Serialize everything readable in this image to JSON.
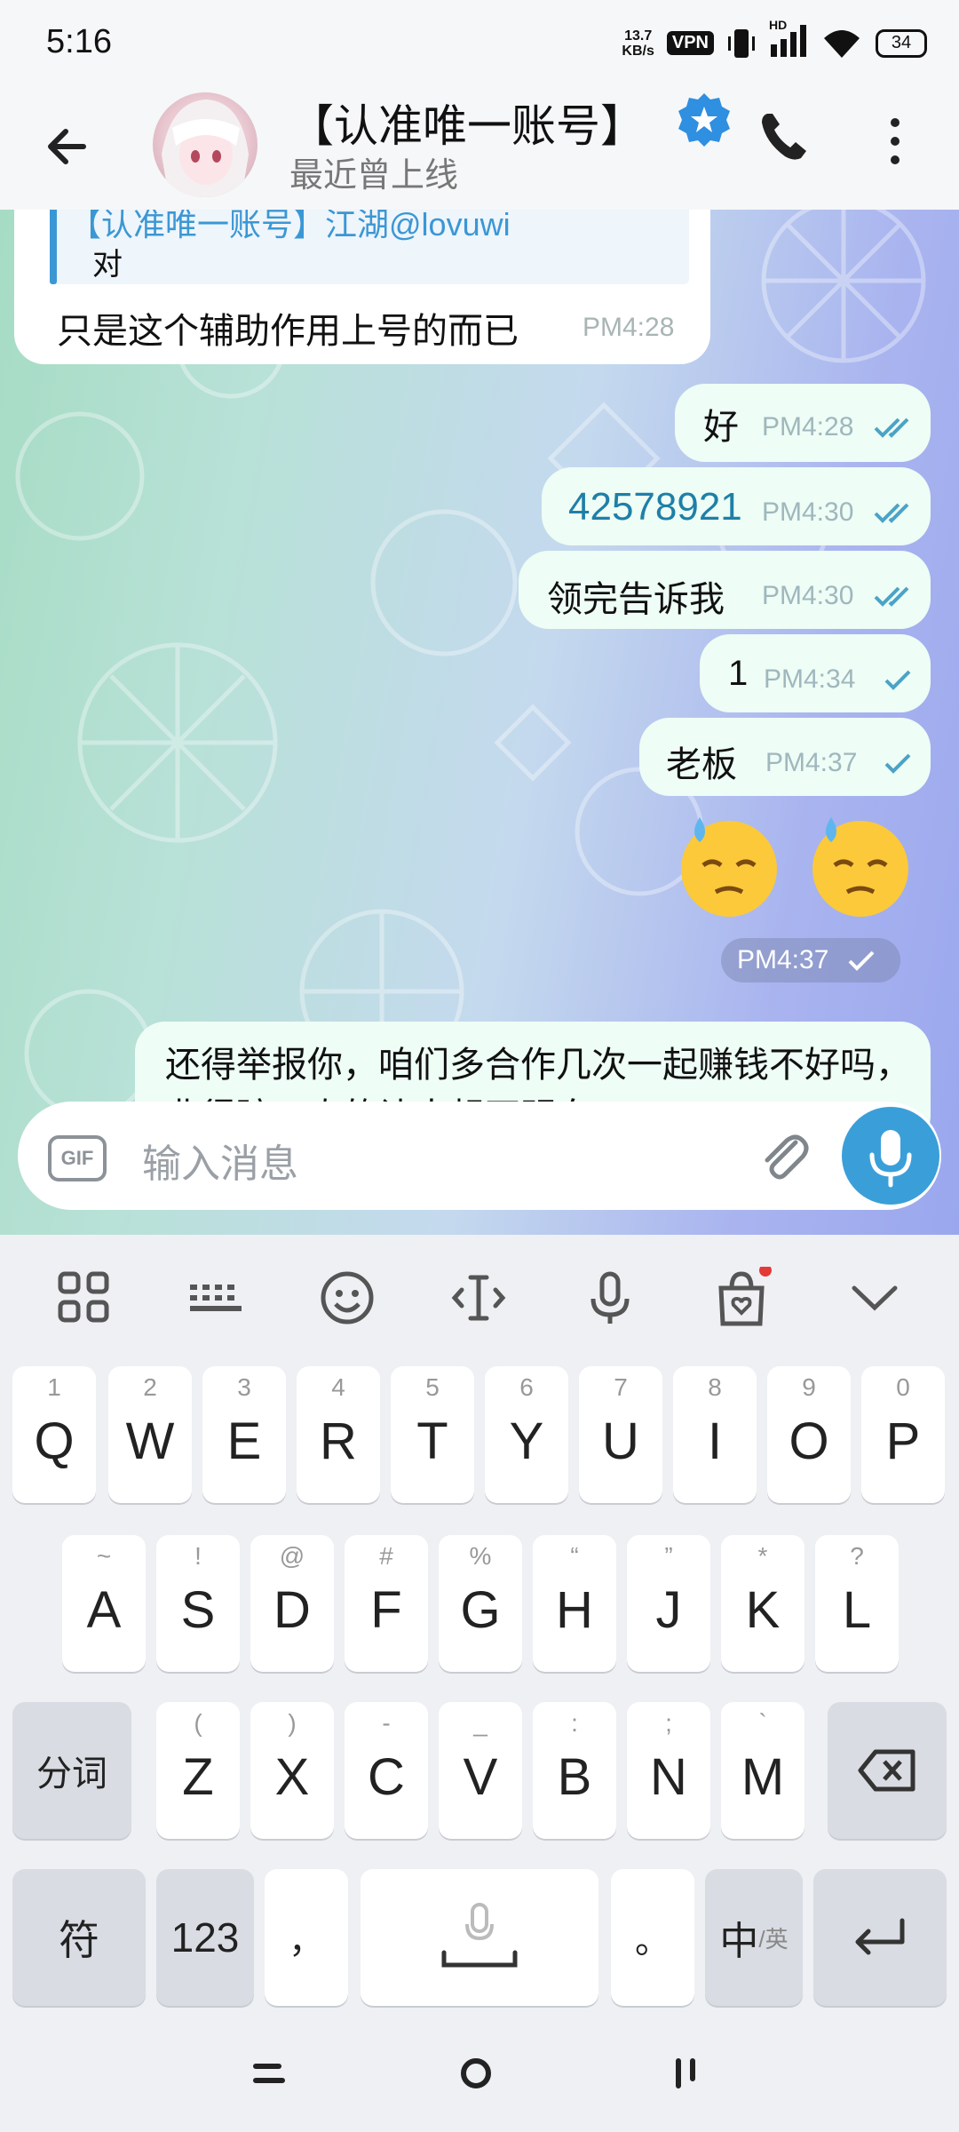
{
  "status_bar": {
    "time": "5:16",
    "net_speed_value": "13.7",
    "net_speed_unit": "KB/s",
    "vpn": "VPN",
    "signal_label": "HD",
    "battery": "34"
  },
  "header": {
    "title": "【认准唯一账号】",
    "subtitle": "最近曾上线"
  },
  "messages": [
    {
      "direction": "in",
      "reply_to_name": "【认准唯一账号】江湖@lovuwi",
      "reply_to_text": "对",
      "text": "只是这个辅助作用上号的而已",
      "time": "PM4:28"
    },
    {
      "direction": "out",
      "text": "好",
      "time": "PM4:28",
      "status": "read"
    },
    {
      "direction": "out",
      "text": "42578921",
      "time": "PM4:30",
      "status": "read"
    },
    {
      "direction": "out",
      "text": "领完告诉我",
      "time": "PM4:30",
      "status": "read"
    },
    {
      "direction": "out",
      "text": "1",
      "time": "PM4:34",
      "status": "sent"
    },
    {
      "direction": "out",
      "text": "老板",
      "time": "PM4:37",
      "status": "sent"
    },
    {
      "direction": "out",
      "type": "emoji",
      "emoji": [
        "downcast-face-with-sweat",
        "downcast-face-with-sweat"
      ],
      "time": "PM4:37",
      "status": "sent"
    },
    {
      "direction": "out",
      "text": "还得举报你，咱们多合作几次一起赚钱不好吗，非得骗，真的让人想不明白",
      "time": ""
    }
  ],
  "composer": {
    "gif_label": "GIF",
    "placeholder": "输入消息"
  },
  "keyboard": {
    "toolbar_icons": [
      "grid-icon",
      "keyboard-icon",
      "emoji-icon",
      "cursor-icon",
      "voice-icon",
      "shop-bag-icon",
      "collapse-icon"
    ],
    "row1": [
      {
        "hint": "1",
        "key": "Q"
      },
      {
        "hint": "2",
        "key": "W"
      },
      {
        "hint": "3",
        "key": "E"
      },
      {
        "hint": "4",
        "key": "R"
      },
      {
        "hint": "5",
        "key": "T"
      },
      {
        "hint": "6",
        "key": "Y"
      },
      {
        "hint": "7",
        "key": "U"
      },
      {
        "hint": "8",
        "key": "I"
      },
      {
        "hint": "9",
        "key": "O"
      },
      {
        "hint": "0",
        "key": "P"
      }
    ],
    "row2": [
      {
        "hint": "~",
        "key": "A"
      },
      {
        "hint": "!",
        "key": "S"
      },
      {
        "hint": "@",
        "key": "D"
      },
      {
        "hint": "#",
        "key": "F"
      },
      {
        "hint": "%",
        "key": "G"
      },
      {
        "hint": "“",
        "key": "H"
      },
      {
        "hint": "”",
        "key": "J"
      },
      {
        "hint": "*",
        "key": "K"
      },
      {
        "hint": "?",
        "key": "L"
      }
    ],
    "row3": [
      {
        "hint": "(",
        "key": "Z"
      },
      {
        "hint": ")",
        "key": "X"
      },
      {
        "hint": "-",
        "key": "C"
      },
      {
        "hint": "_",
        "key": "V"
      },
      {
        "hint": ":",
        "key": "B"
      },
      {
        "hint": ";",
        "key": "N"
      },
      {
        "hint": "`",
        "key": "M"
      }
    ],
    "segment_key": "分词",
    "symbol_key": "符",
    "numeric_key": "123",
    "comma_key": "，",
    "period_key": "。",
    "lang_key_main": "中",
    "lang_key_alt": "/英"
  },
  "colors": {
    "accent": "#3a9fd9",
    "outgoing_bubble": "#eefdf5",
    "incoming_bubble": "#ffffff",
    "check_read": "#4ba3c7"
  }
}
